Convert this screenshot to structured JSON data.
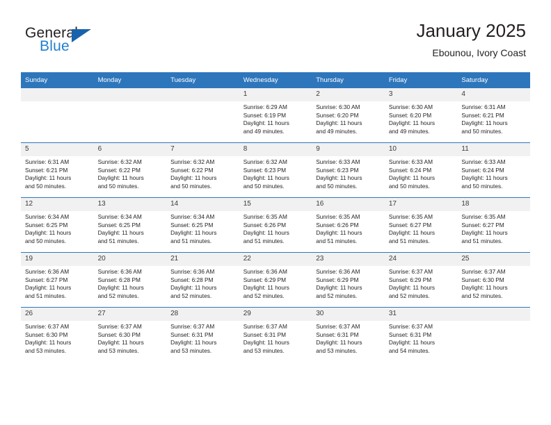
{
  "brand": {
    "name_top": "General",
    "name_bottom": "Blue",
    "triangle_color": "#1a62ac",
    "blue_color": "#1f7fd0"
  },
  "header": {
    "title": "January 2025",
    "subtitle": "Ebounou, Ivory Coast"
  },
  "theme": {
    "header_bg": "#2e76bc",
    "daynum_bg": "#f1f1f1",
    "grid_line": "#2e76bc",
    "text": "#231f20"
  },
  "weekday_headers": [
    "Sunday",
    "Monday",
    "Tuesday",
    "Wednesday",
    "Thursday",
    "Friday",
    "Saturday"
  ],
  "weeks": [
    [
      {
        "day": "",
        "empty": true
      },
      {
        "day": "",
        "empty": true
      },
      {
        "day": "",
        "empty": true
      },
      {
        "day": "1",
        "sunrise": "Sunrise: 6:29 AM",
        "sunset": "Sunset: 6:19 PM",
        "daylight1": "Daylight: 11 hours",
        "daylight2": "and 49 minutes."
      },
      {
        "day": "2",
        "sunrise": "Sunrise: 6:30 AM",
        "sunset": "Sunset: 6:20 PM",
        "daylight1": "Daylight: 11 hours",
        "daylight2": "and 49 minutes."
      },
      {
        "day": "3",
        "sunrise": "Sunrise: 6:30 AM",
        "sunset": "Sunset: 6:20 PM",
        "daylight1": "Daylight: 11 hours",
        "daylight2": "and 49 minutes."
      },
      {
        "day": "4",
        "sunrise": "Sunrise: 6:31 AM",
        "sunset": "Sunset: 6:21 PM",
        "daylight1": "Daylight: 11 hours",
        "daylight2": "and 50 minutes."
      }
    ],
    [
      {
        "day": "5",
        "sunrise": "Sunrise: 6:31 AM",
        "sunset": "Sunset: 6:21 PM",
        "daylight1": "Daylight: 11 hours",
        "daylight2": "and 50 minutes."
      },
      {
        "day": "6",
        "sunrise": "Sunrise: 6:32 AM",
        "sunset": "Sunset: 6:22 PM",
        "daylight1": "Daylight: 11 hours",
        "daylight2": "and 50 minutes."
      },
      {
        "day": "7",
        "sunrise": "Sunrise: 6:32 AM",
        "sunset": "Sunset: 6:22 PM",
        "daylight1": "Daylight: 11 hours",
        "daylight2": "and 50 minutes."
      },
      {
        "day": "8",
        "sunrise": "Sunrise: 6:32 AM",
        "sunset": "Sunset: 6:23 PM",
        "daylight1": "Daylight: 11 hours",
        "daylight2": "and 50 minutes."
      },
      {
        "day": "9",
        "sunrise": "Sunrise: 6:33 AM",
        "sunset": "Sunset: 6:23 PM",
        "daylight1": "Daylight: 11 hours",
        "daylight2": "and 50 minutes."
      },
      {
        "day": "10",
        "sunrise": "Sunrise: 6:33 AM",
        "sunset": "Sunset: 6:24 PM",
        "daylight1": "Daylight: 11 hours",
        "daylight2": "and 50 minutes."
      },
      {
        "day": "11",
        "sunrise": "Sunrise: 6:33 AM",
        "sunset": "Sunset: 6:24 PM",
        "daylight1": "Daylight: 11 hours",
        "daylight2": "and 50 minutes."
      }
    ],
    [
      {
        "day": "12",
        "sunrise": "Sunrise: 6:34 AM",
        "sunset": "Sunset: 6:25 PM",
        "daylight1": "Daylight: 11 hours",
        "daylight2": "and 50 minutes."
      },
      {
        "day": "13",
        "sunrise": "Sunrise: 6:34 AM",
        "sunset": "Sunset: 6:25 PM",
        "daylight1": "Daylight: 11 hours",
        "daylight2": "and 51 minutes."
      },
      {
        "day": "14",
        "sunrise": "Sunrise: 6:34 AM",
        "sunset": "Sunset: 6:25 PM",
        "daylight1": "Daylight: 11 hours",
        "daylight2": "and 51 minutes."
      },
      {
        "day": "15",
        "sunrise": "Sunrise: 6:35 AM",
        "sunset": "Sunset: 6:26 PM",
        "daylight1": "Daylight: 11 hours",
        "daylight2": "and 51 minutes."
      },
      {
        "day": "16",
        "sunrise": "Sunrise: 6:35 AM",
        "sunset": "Sunset: 6:26 PM",
        "daylight1": "Daylight: 11 hours",
        "daylight2": "and 51 minutes."
      },
      {
        "day": "17",
        "sunrise": "Sunrise: 6:35 AM",
        "sunset": "Sunset: 6:27 PM",
        "daylight1": "Daylight: 11 hours",
        "daylight2": "and 51 minutes."
      },
      {
        "day": "18",
        "sunrise": "Sunrise: 6:35 AM",
        "sunset": "Sunset: 6:27 PM",
        "daylight1": "Daylight: 11 hours",
        "daylight2": "and 51 minutes."
      }
    ],
    [
      {
        "day": "19",
        "sunrise": "Sunrise: 6:36 AM",
        "sunset": "Sunset: 6:27 PM",
        "daylight1": "Daylight: 11 hours",
        "daylight2": "and 51 minutes."
      },
      {
        "day": "20",
        "sunrise": "Sunrise: 6:36 AM",
        "sunset": "Sunset: 6:28 PM",
        "daylight1": "Daylight: 11 hours",
        "daylight2": "and 52 minutes."
      },
      {
        "day": "21",
        "sunrise": "Sunrise: 6:36 AM",
        "sunset": "Sunset: 6:28 PM",
        "daylight1": "Daylight: 11 hours",
        "daylight2": "and 52 minutes."
      },
      {
        "day": "22",
        "sunrise": "Sunrise: 6:36 AM",
        "sunset": "Sunset: 6:29 PM",
        "daylight1": "Daylight: 11 hours",
        "daylight2": "and 52 minutes."
      },
      {
        "day": "23",
        "sunrise": "Sunrise: 6:36 AM",
        "sunset": "Sunset: 6:29 PM",
        "daylight1": "Daylight: 11 hours",
        "daylight2": "and 52 minutes."
      },
      {
        "day": "24",
        "sunrise": "Sunrise: 6:37 AM",
        "sunset": "Sunset: 6:29 PM",
        "daylight1": "Daylight: 11 hours",
        "daylight2": "and 52 minutes."
      },
      {
        "day": "25",
        "sunrise": "Sunrise: 6:37 AM",
        "sunset": "Sunset: 6:30 PM",
        "daylight1": "Daylight: 11 hours",
        "daylight2": "and 52 minutes."
      }
    ],
    [
      {
        "day": "26",
        "sunrise": "Sunrise: 6:37 AM",
        "sunset": "Sunset: 6:30 PM",
        "daylight1": "Daylight: 11 hours",
        "daylight2": "and 53 minutes."
      },
      {
        "day": "27",
        "sunrise": "Sunrise: 6:37 AM",
        "sunset": "Sunset: 6:30 PM",
        "daylight1": "Daylight: 11 hours",
        "daylight2": "and 53 minutes."
      },
      {
        "day": "28",
        "sunrise": "Sunrise: 6:37 AM",
        "sunset": "Sunset: 6:31 PM",
        "daylight1": "Daylight: 11 hours",
        "daylight2": "and 53 minutes."
      },
      {
        "day": "29",
        "sunrise": "Sunrise: 6:37 AM",
        "sunset": "Sunset: 6:31 PM",
        "daylight1": "Daylight: 11 hours",
        "daylight2": "and 53 minutes."
      },
      {
        "day": "30",
        "sunrise": "Sunrise: 6:37 AM",
        "sunset": "Sunset: 6:31 PM",
        "daylight1": "Daylight: 11 hours",
        "daylight2": "and 53 minutes."
      },
      {
        "day": "31",
        "sunrise": "Sunrise: 6:37 AM",
        "sunset": "Sunset: 6:31 PM",
        "daylight1": "Daylight: 11 hours",
        "daylight2": "and 54 minutes."
      },
      {
        "day": "",
        "empty": true
      }
    ]
  ]
}
